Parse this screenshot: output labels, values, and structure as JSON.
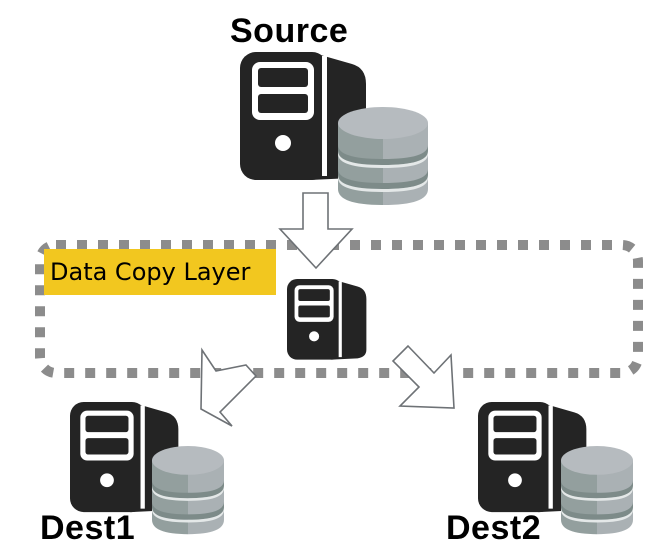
{
  "diagram": {
    "nodes": {
      "source": {
        "label": "Source",
        "icons": [
          "server-icon",
          "database-icon"
        ]
      },
      "copy_layer_server": {
        "icons": [
          "server-icon"
        ]
      },
      "dest1": {
        "label": "Dest1",
        "icons": [
          "server-icon",
          "database-icon"
        ]
      },
      "dest2": {
        "label": "Dest2",
        "icons": [
          "server-icon",
          "database-icon"
        ]
      }
    },
    "groups": {
      "copy_layer": {
        "label": "Data Copy Layer",
        "label_bg": "#f2c71f",
        "border": "dotted",
        "border_color": "#8c8c8c"
      }
    },
    "edges": [
      {
        "from": "source",
        "to": "copy_layer_server",
        "style": "hollow-arrow"
      },
      {
        "from": "copy_layer_server",
        "to": "dest1",
        "style": "hollow-arrow"
      },
      {
        "from": "copy_layer_server",
        "to": "dest2",
        "style": "hollow-arrow"
      }
    ],
    "colors": {
      "server": "#242424",
      "db_light": "#b4bbbe",
      "db_dark": "#939f9e",
      "arrow_stroke": "#6e7276"
    }
  }
}
